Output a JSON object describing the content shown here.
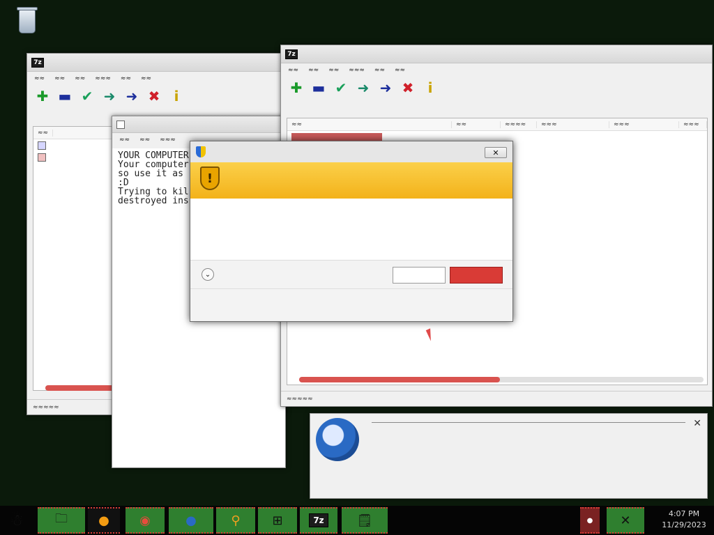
{
  "desktop": {
    "recycle_bin_label": ""
  },
  "win_left": {
    "title": "",
    "files": [
      "",
      ""
    ]
  },
  "win_right": {
    "title": "",
    "columns": [
      "",
      "",
      "",
      "",
      "",
      ""
    ]
  },
  "notepad": {
    "title": "",
    "lines": [
      "YOUR COMPUTER",
      "",
      "Your computer",
      "so use it as",
      "",
      ":D",
      "",
      "Trying to kil",
      "destroyed ins"
    ]
  },
  "uac": {
    "title": "",
    "question": "",
    "program_name_label": "",
    "program_name": "",
    "publisher_label": "",
    "publisher": "",
    "file_origin_label": "",
    "file_origin": "",
    "show_details": "",
    "yes_label": "",
    "no_label": "",
    "settings_link": ""
  },
  "toast": {
    "title": "",
    "line1": "",
    "line2": "",
    "line3": "",
    "line4": ""
  },
  "clock": {
    "time": "4:07 PM",
    "date": "11/29/2023"
  },
  "colors": {
    "desktop": "#0b1a0b",
    "uac_band": "#f3b21a",
    "no_button": "#d93b36",
    "taskbar_slot": "#2f7f2f"
  }
}
